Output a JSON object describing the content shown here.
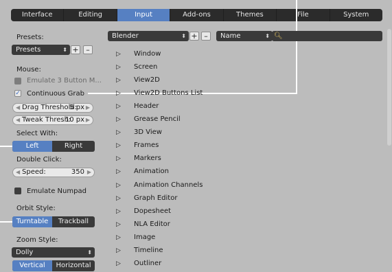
{
  "tabs": [
    {
      "label": "Interface",
      "active": false
    },
    {
      "label": "Editing",
      "active": false
    },
    {
      "label": "Input",
      "active": true
    },
    {
      "label": "Add-ons",
      "active": false
    },
    {
      "label": "Themes",
      "active": false
    },
    {
      "label": "File",
      "active": false
    },
    {
      "label": "System",
      "active": false
    }
  ],
  "left": {
    "presets_label": "Presets:",
    "presets_value": "Presets",
    "add_symbol": "+",
    "remove_symbol": "–",
    "mouse_label": "Mouse:",
    "emulate_3_button": "Emulate 3 Button M...",
    "continuous_grab": "Continuous Grab",
    "drag_threshold_label": "Drag Threshold:",
    "drag_threshold_value": "5 px",
    "tweak_thresh_label": "Tweak Thresh:",
    "tweak_thresh_value": "10 px",
    "select_with_label": "Select With:",
    "select_left": "Left",
    "select_right": "Right",
    "double_click_label": "Double Click:",
    "speed_label": "Speed:",
    "speed_value": "350",
    "emulate_numpad": "Emulate Numpad",
    "orbit_style_label": "Orbit Style:",
    "orbit_turntable": "Turntable",
    "orbit_trackball": "Trackball",
    "zoom_style_label": "Zoom Style:",
    "zoom_style_value": "Dolly",
    "zoom_vertical": "Vertical",
    "zoom_horizontal": "Horizontal"
  },
  "right": {
    "keymap_preset": "Blender",
    "search_mode": "Name",
    "add_symbol": "+",
    "remove_symbol": "–",
    "items": [
      "Window",
      "Screen",
      "View2D",
      "View2D Buttons List",
      "Header",
      "Grease Pencil",
      "3D View",
      "Frames",
      "Markers",
      "Animation",
      "Animation Channels",
      "Graph Editor",
      "Dopesheet",
      "NLA Editor",
      "Image",
      "Timeline",
      "Outliner"
    ]
  },
  "colors": {
    "accent": "#5680c2",
    "panel": "#bcbcbc",
    "widget_dark": "#3a3a3a"
  },
  "icons": {
    "expand": "triangle-right-icon",
    "search": "magnifier-icon",
    "checkbox": "checkmark-icon"
  }
}
